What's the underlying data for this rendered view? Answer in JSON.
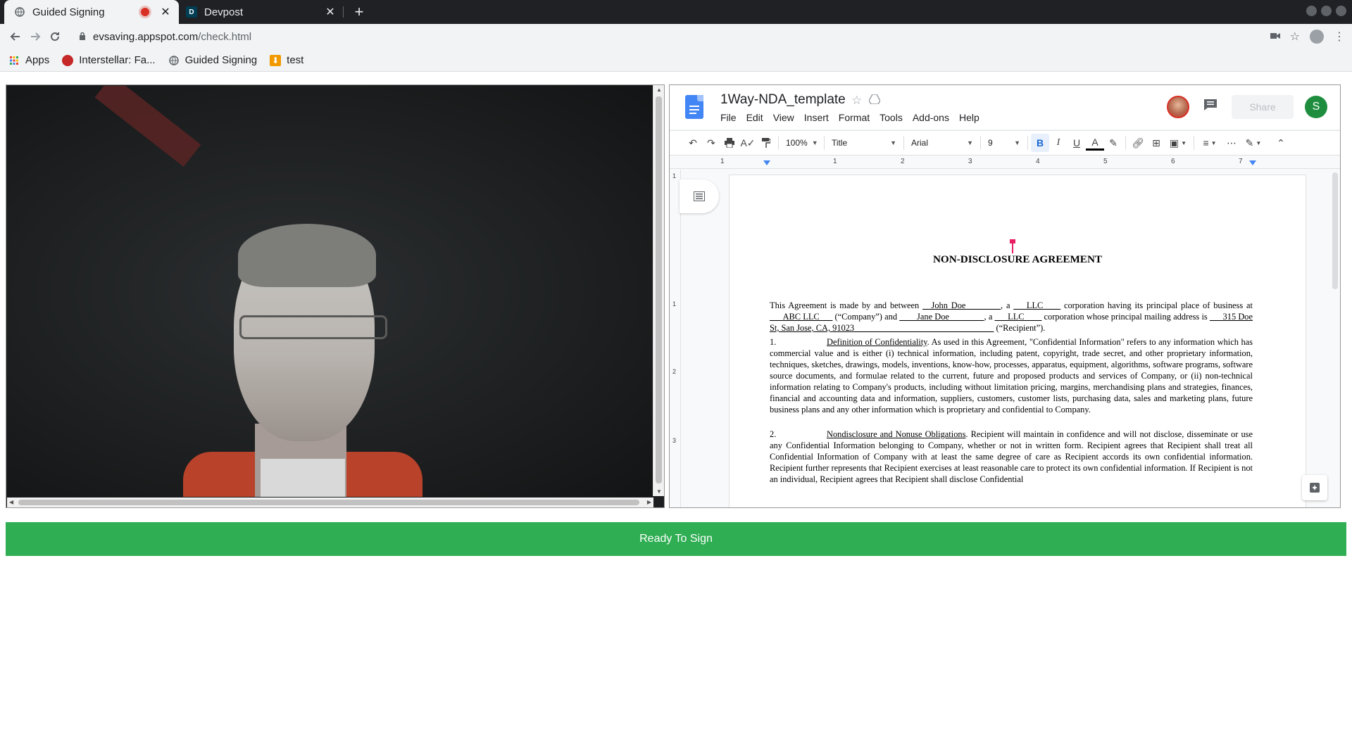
{
  "browser": {
    "tabs": [
      {
        "title": "Guided Signing",
        "active": true
      },
      {
        "title": "Devpost",
        "active": false
      }
    ],
    "favicon_devpost": "D",
    "new_tab_label": "+",
    "url_domain": "evsaving.appspot.com",
    "url_path": "/check.html",
    "bookmarks": [
      {
        "label": "Apps",
        "icon": "apps-grid-icon"
      },
      {
        "label": "Interstellar: Fa...",
        "icon": "interstellar-icon"
      },
      {
        "label": "Guided Signing",
        "icon": "globe-icon"
      },
      {
        "label": "test",
        "icon": "bookmark-orange-icon"
      }
    ]
  },
  "docs": {
    "title": "1Way-NDA_template",
    "menu": [
      "File",
      "Edit",
      "View",
      "Insert",
      "Format",
      "Tools",
      "Add-ons",
      "Help"
    ],
    "share_label": "Share",
    "user_initial": "S",
    "toolbar": {
      "zoom": "100%",
      "style": "Title",
      "font": "Arial",
      "size": "9"
    },
    "ruler_numbers": [
      "1",
      "1",
      "2",
      "3",
      "4",
      "5",
      "6",
      "7"
    ],
    "vruler_numbers": [
      "1",
      "1",
      "2",
      "3"
    ]
  },
  "document": {
    "heading": "NON-DISCLOSURE AGREEMENT",
    "intro": {
      "t1": "This Agreement is made by and between ",
      "party1": "__John Doe________",
      "t2": ", a ",
      "type1": "___LLC____",
      "t3": " corporation having its principal place of business at ",
      "company": "___ABC LLC___",
      "t4": " (“Company”) and ",
      "party2": "____Jane Doe________",
      "t5": ", a ",
      "type2": "___LLC____",
      "t6": " corporation whose principal mailing address is ",
      "address": "___315 Doe St, San Jose, CA, 91023________________________________",
      "t7": " (“Recipient”)."
    },
    "section1": {
      "number": "1.",
      "heading": "Definition of Confidentiality",
      "text": ". As used in this Agreement, \"Confidential Information\" refers to any information which has commercial value and is either (i) technical information, including patent, copyright, trade secret, and other proprietary information, techniques, sketches, drawings, models, inventions, know-how, processes, apparatus, equipment, algorithms, software programs, software source documents, and formulae related to the current, future and proposed products and services of Company, or (ii) non-technical information relating to Company's products, including without limitation pricing, margins, merchandising plans and strategies, finances, financial and accounting data and information, suppliers, customers, customer lists, purchasing data, sales and marketing plans, future business plans and any other information which is proprietary and confidential to Company."
    },
    "section2": {
      "number": "2.",
      "heading": "Nondisclosure and Nonuse Obligations",
      "text": ". Recipient will maintain in confidence and will not disclose, disseminate or use any Confidential Information belonging to Company, whether or not in written form.  Recipient agrees that Recipient shall treat all Confidential Information of Company with at least the same degree of care as Recipient accords its own confidential information.  Recipient further represents that Recipient exercises at least reasonable care to protect its own confidential information.  If Recipient is not an individual, Recipient agrees that Recipient shall disclose Confidential"
    }
  },
  "ready_button_label": "Ready To Sign",
  "colors": {
    "ready_green": "#2fae53",
    "docs_blue": "#4285f4",
    "avatar_green": "#1e8e3e",
    "cursor_pink": "#e91e63"
  }
}
